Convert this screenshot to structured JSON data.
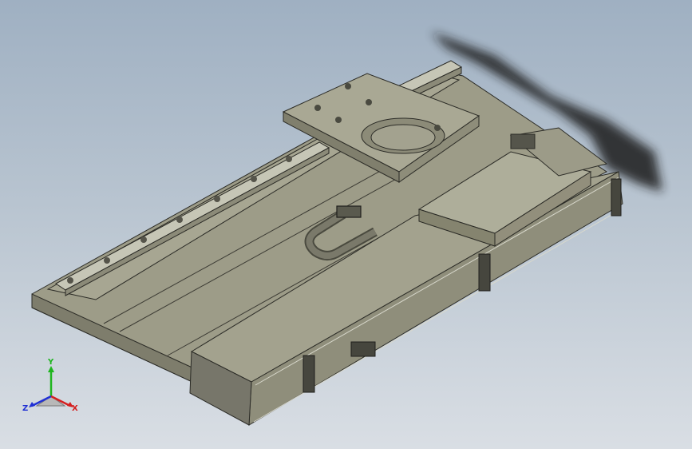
{
  "viewport": {
    "background_top": "#9fb0c2",
    "background_bottom": "#d9dee4",
    "model_color": "#9b9a86",
    "edge_color": "#2b2b26"
  },
  "triad": {
    "x_label": "X",
    "y_label": "Y",
    "z_label": "Z",
    "x_color": "#d42020",
    "y_color": "#1fb51f",
    "z_color": "#2030d4"
  }
}
